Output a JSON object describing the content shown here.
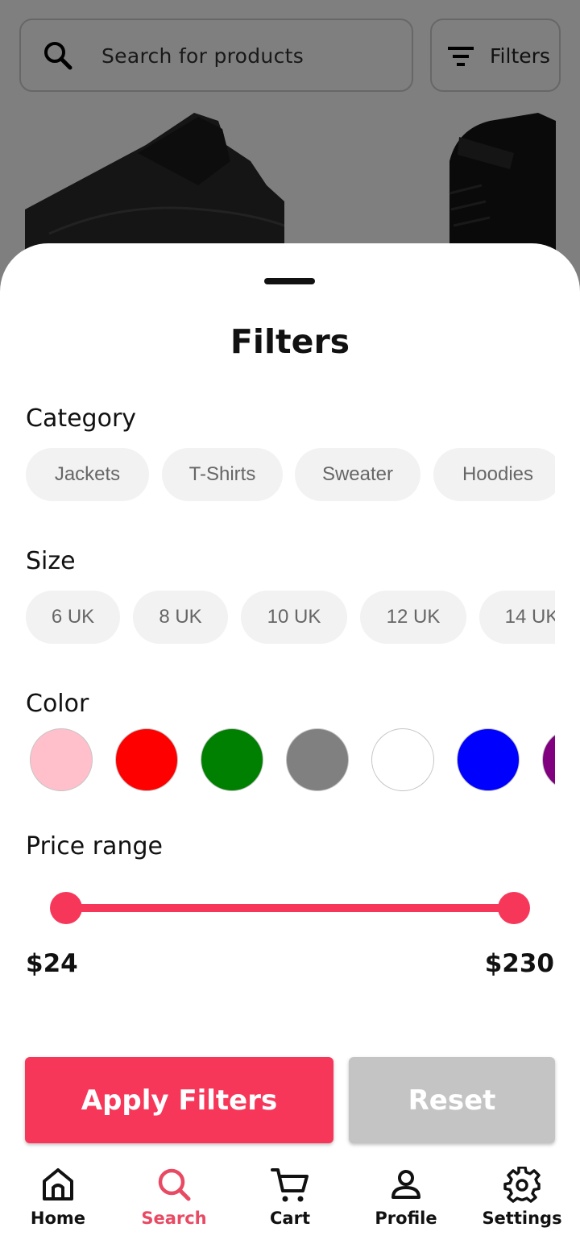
{
  "search": {
    "placeholder": "Search for products"
  },
  "filters_button": {
    "label": "Filters",
    "icon": "filter-lines-icon"
  },
  "sheet": {
    "title": "Filters",
    "category": {
      "label": "Category",
      "options": [
        "Jackets",
        "T-Shirts",
        "Sweater",
        "Hoodies"
      ]
    },
    "size": {
      "label": "Size",
      "options": [
        "6 UK",
        "8 UK",
        "10 UK",
        "12 UK",
        "14 UK"
      ]
    },
    "color": {
      "label": "Color",
      "options": [
        "#ffc0cb",
        "#ff0000",
        "#008000",
        "#808080",
        "#ffffff",
        "#0000ff",
        "#800080"
      ]
    },
    "price": {
      "label": "Price range",
      "min_label": "$24",
      "max_label": "$230",
      "selected_min_fraction": 0,
      "selected_max_fraction": 1
    },
    "apply_label": "Apply Filters",
    "reset_label": "Reset"
  },
  "nav": {
    "items": [
      {
        "label": "Home",
        "icon": "home-icon",
        "active": false
      },
      {
        "label": "Search",
        "icon": "search-icon",
        "active": true
      },
      {
        "label": "Cart",
        "icon": "cart-icon",
        "active": false
      },
      {
        "label": "Profile",
        "icon": "profile-icon",
        "active": false
      },
      {
        "label": "Settings",
        "icon": "gear-icon",
        "active": false
      }
    ]
  },
  "colors": {
    "accent": "#f7375a",
    "nav_active": "#e84a63",
    "reset": "#c4c4c4"
  }
}
